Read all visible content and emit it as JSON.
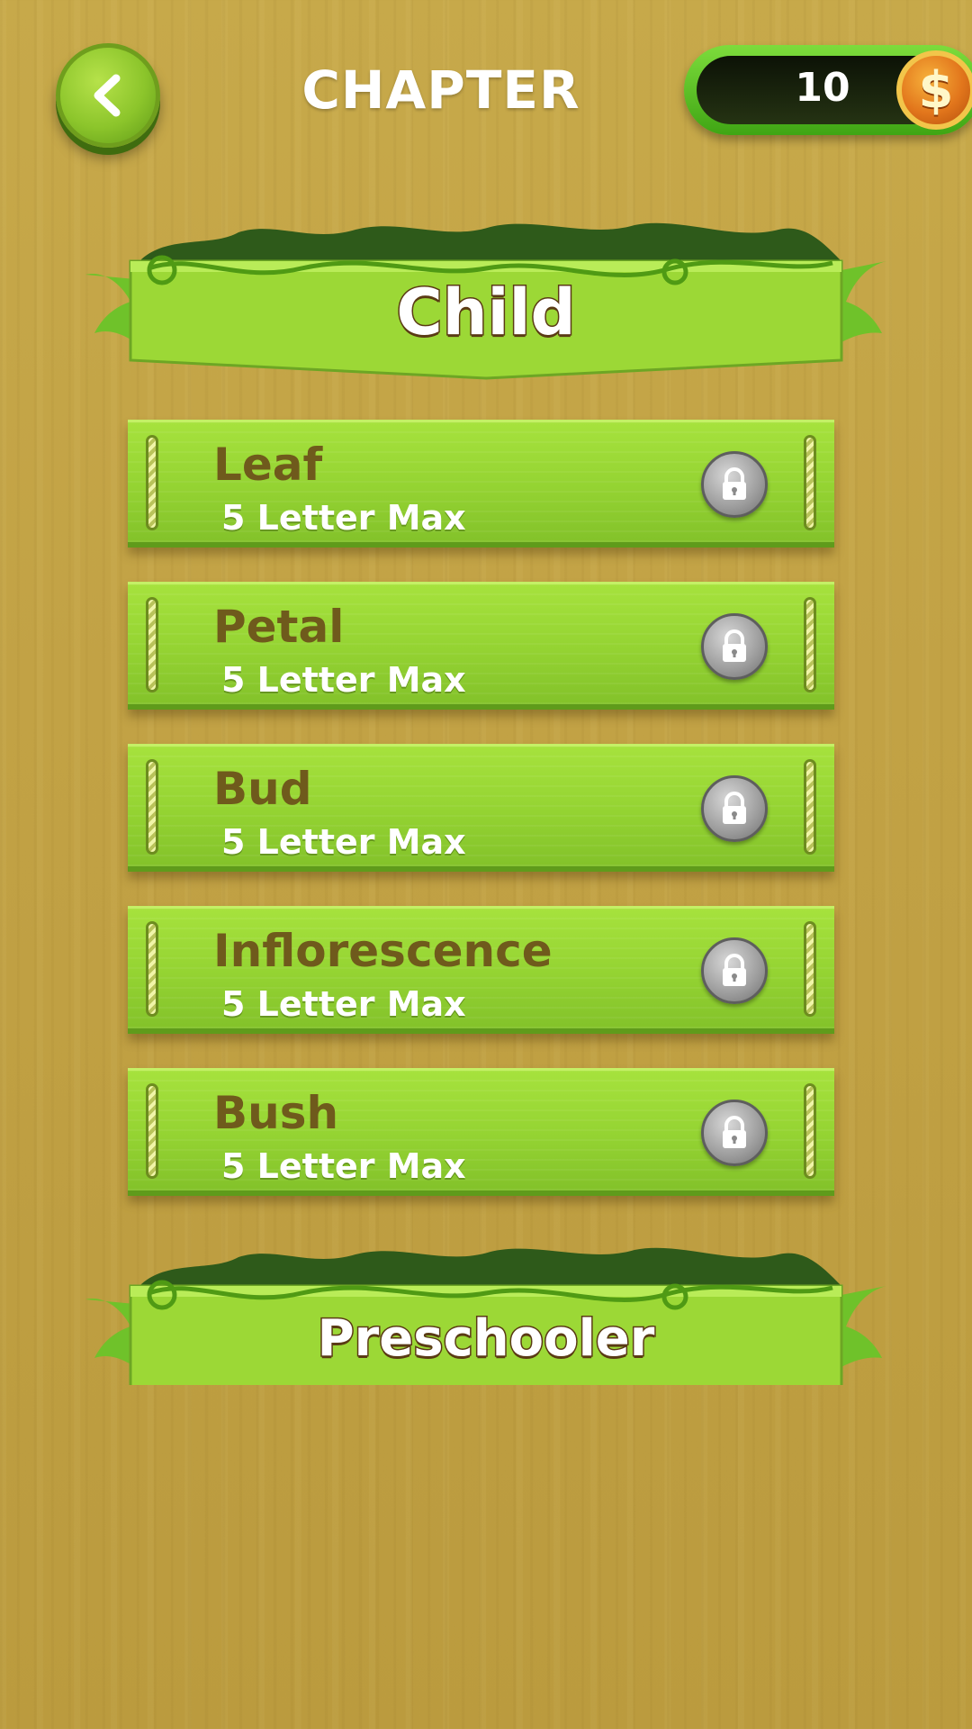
{
  "header": {
    "title": "CHAPTER",
    "back_icon": "chevron-left-icon",
    "coins": "10",
    "coin_icon": "dollar-coin-icon",
    "coin_symbol": "$"
  },
  "chapters": [
    {
      "title": "Child",
      "levels": [
        {
          "name": "Leaf",
          "subtitle": "5 Letter Max",
          "locked": true
        },
        {
          "name": "Petal",
          "subtitle": "5 Letter Max",
          "locked": true
        },
        {
          "name": "Bud",
          "subtitle": "5 Letter Max",
          "locked": true
        },
        {
          "name": "Inflorescence",
          "subtitle": "5 Letter Max",
          "locked": true
        },
        {
          "name": "Bush",
          "subtitle": "5 Letter Max",
          "locked": true
        }
      ]
    },
    {
      "title": "Preschooler"
    }
  ],
  "colors": {
    "background": "#c2a245",
    "card_green": "#94d332",
    "level_text": "#6f5a1c",
    "lock_gray": "#9c9c9c"
  }
}
